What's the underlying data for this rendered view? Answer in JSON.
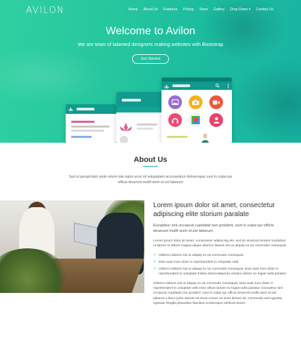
{
  "brand": "AVILON",
  "nav": [
    "Home",
    "About Us",
    "Features",
    "Pricing",
    "Team",
    "Gallery",
    "Drop Down ▾",
    "Contact Us"
  ],
  "hero": {
    "title": "Welcome to Avilon",
    "subtitle": "We are team of talanted designers making websites with Bootstrap",
    "cta": "Get Started"
  },
  "about": {
    "title": "About Us",
    "text": "Sed ut perspiciatis unde omnis iste natus error sit voluptatem accusantium doloremque sunt in culpa qui officia deserunt mollit anim id est laborum"
  },
  "feature": {
    "heading": "Lorem ipsum dolor sit amet, consectetur adipiscing elite storium paralate",
    "lead": "Excepteur sint occaecat cupidatat non proident, sunt in culpa qui officia deserunt mollit anim id est laborum.",
    "para1": "Lorem ipsum dolor sit amet, consectetur adipiscing elit, sed do eiusmod tempor incididunt ut labore et dolore magna aliqua ullamco laboris nisi ut aliquip ex ea commodo consequat.",
    "checks": [
      "Ullamco laboris nisi ut aliquip ex ea commodo consequat.",
      "Duis aute irure dolor in reprehenderit in voluptate velit.",
      "Ullamco laboris nisi ut aliquip ex ea commodo consequat. Duis aute irure dolor in reprehenderit in voluptate trideta storacalaperda mastiro dolore eu fugiat nulla pariatur."
    ],
    "para2": "Ullamco laboris nisi ut aliquip ex ea commodo consequat. Duis aute irure dolor in reprehenderit in voluptate velit esse cillum dolore eu fugiat nulla pariatur. Excepteur sint occaecat cupidatat non proident, sunt in culpa qui officia deserunt mollit anim id est laborum Libero justo laoreet sit amet cursus sit amet dictum sit. Commodo sed egestas egestas fringilla phasellus faucibus scelerisque eleifend donec"
  },
  "colors": {
    "accent": "#1bbd9f",
    "phone_bar": "#0f9b8e"
  },
  "app_icons": [
    "image-icon",
    "camera-icon",
    "video-icon",
    "headphones-icon",
    "maps-icon",
    "contacts-icon"
  ]
}
